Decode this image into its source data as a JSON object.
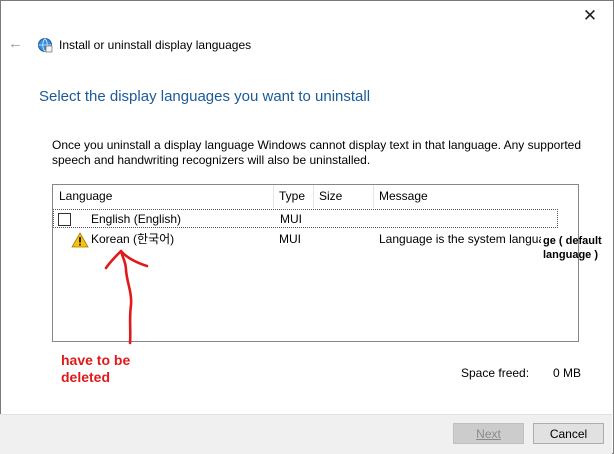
{
  "window": {
    "title": "Install or uninstall display languages",
    "close_glyph": "✕",
    "back_glyph": "←"
  },
  "heading": "Select the display languages you want to uninstall",
  "description": "Once you uninstall a display language Windows cannot display text in that language. Any supported speech and handwriting recognizers will also be uninstalled.",
  "table": {
    "columns": [
      "Language",
      "Type",
      "Size",
      "Message"
    ],
    "rows": [
      {
        "language": "English (English)",
        "type": "MUI",
        "size": "",
        "message": "",
        "checked": false,
        "icon": "checkbox"
      },
      {
        "language": "Korean (한국어)",
        "type": "MUI",
        "size": "",
        "message": "Language is the system language",
        "icon": "warning-icon"
      }
    ]
  },
  "summary": {
    "space_freed_label": "Space freed:",
    "space_freed_value": "0 MB"
  },
  "buttons": {
    "next": "Next",
    "cancel": "Cancel"
  },
  "annotations": {
    "default_note": "ge ( default language )",
    "delete_note": "have to be deleted",
    "color": "#e01a1a"
  },
  "colors": {
    "heading": "#1c5a96",
    "footer": "#f0f0f0"
  }
}
